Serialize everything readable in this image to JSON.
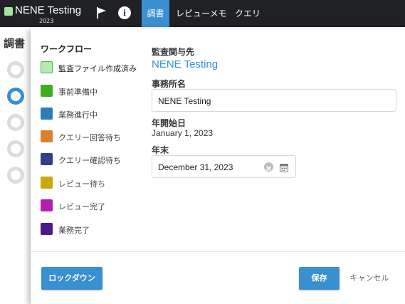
{
  "topbar": {
    "brand": {
      "name": "NENE Testing",
      "year": "2023",
      "color": "#a6e3a1"
    },
    "icons": {
      "flag": "flag-icon",
      "info": "info-icon"
    },
    "tabs": [
      {
        "label": "調書",
        "active": true
      },
      {
        "label": "レビューメモ",
        "active": false
      },
      {
        "label": "クエリ",
        "active": false
      }
    ]
  },
  "background": {
    "title": "調書",
    "accent": "#3a8fd0"
  },
  "workflow": {
    "title": "ワークフロー",
    "items": [
      {
        "label": "監査ファイル作成済み",
        "color": "#b5eab0",
        "selected": true
      },
      {
        "label": "事前準備中",
        "color": "#3fae1c"
      },
      {
        "label": "業務進行中",
        "color": "#2e7cb8"
      },
      {
        "label": "クエリー回答待ち",
        "color": "#d9822b"
      },
      {
        "label": "クエリー確認待ち",
        "color": "#2f3f8a"
      },
      {
        "label": "レビュー待ち",
        "color": "#c9a90a"
      },
      {
        "label": "レビュー完了",
        "color": "#b21fb0"
      },
      {
        "label": "業務完了",
        "color": "#4a1a8a"
      }
    ]
  },
  "form": {
    "client_label": "監査関与先",
    "client_name": "NENE Testing",
    "office_label": "事務所名",
    "office_value": "NENE Testing",
    "start_label": "年開始日",
    "start_value": "January 1, 2023",
    "end_label": "年末",
    "end_value": "December 31, 2023"
  },
  "footer": {
    "lockdown_label": "ロックダウン",
    "save_label": "保存",
    "cancel_label": "キャンセル"
  }
}
